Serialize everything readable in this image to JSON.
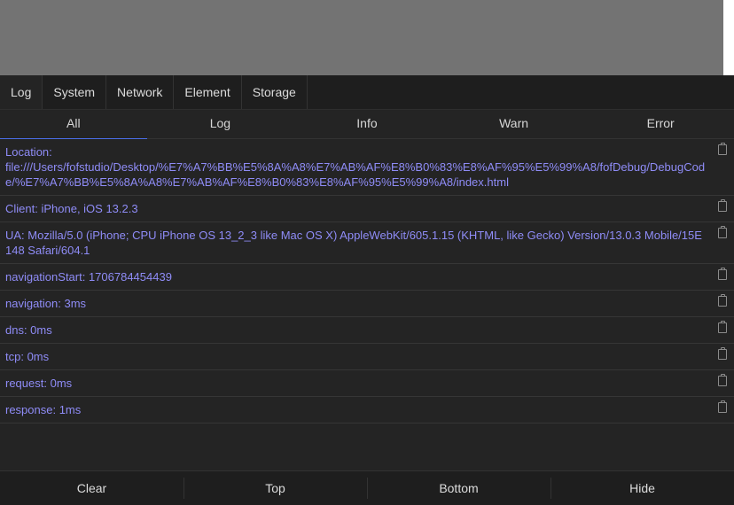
{
  "tabs": [
    "Log",
    "System",
    "Network",
    "Element",
    "Storage"
  ],
  "subtabs": [
    "All",
    "Log",
    "Info",
    "Warn",
    "Error"
  ],
  "logs": [
    "Location:\nfile:///Users/fofstudio/Desktop/%E7%A7%BB%E5%8A%A8%E7%AB%AF%E8%B0%83%E8%AF%95%E5%99%A8/fofDebug/DebugCode/%E7%A7%BB%E5%8A%A8%E7%AB%AF%E8%B0%83%E8%AF%95%E5%99%A8/index.html",
    "Client: iPhone, iOS 13.2.3",
    "UA: Mozilla/5.0 (iPhone; CPU iPhone OS 13_2_3 like Mac OS X) AppleWebKit/605.1.15 (KHTML, like Gecko) Version/13.0.3 Mobile/15E148 Safari/604.1",
    "navigationStart: 1706784454439",
    "navigation: 3ms",
    "dns: 0ms",
    "tcp: 0ms",
    "request: 0ms",
    "response: 1ms"
  ],
  "footer": [
    "Clear",
    "Top",
    "Bottom",
    "Hide"
  ],
  "colors": {
    "log_text": "#8f8cf7",
    "active_underline": "#4b6ee8"
  }
}
